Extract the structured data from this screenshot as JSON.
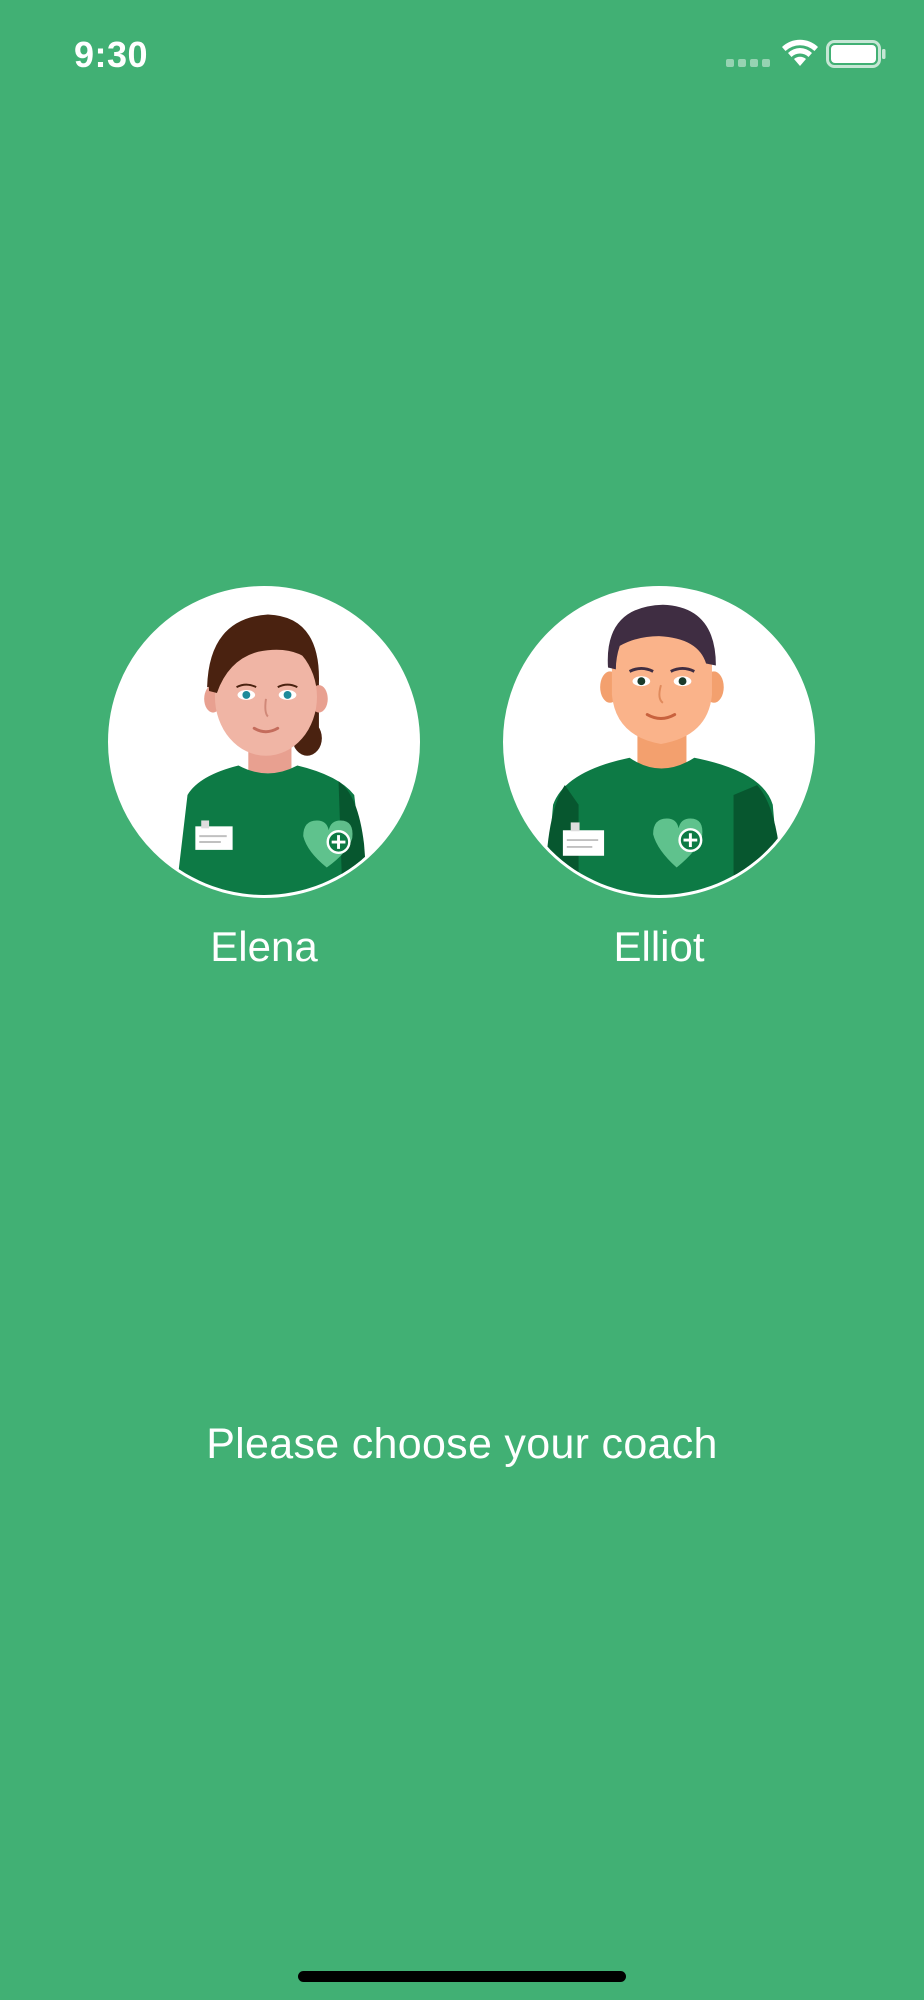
{
  "status_bar": {
    "time": "9:30",
    "icons": [
      "cellular-signal-icon",
      "wifi-icon",
      "battery-icon"
    ]
  },
  "coaches": [
    {
      "name": "Elena",
      "avatar_icon": "female-coach-avatar"
    },
    {
      "name": "Elliot",
      "avatar_icon": "male-coach-avatar"
    }
  ],
  "prompt": "Please choose your coach",
  "colors": {
    "background": "#41b074",
    "shirt": "#0d7a45",
    "shirt_dark": "#07572f",
    "text": "#ffffff"
  }
}
